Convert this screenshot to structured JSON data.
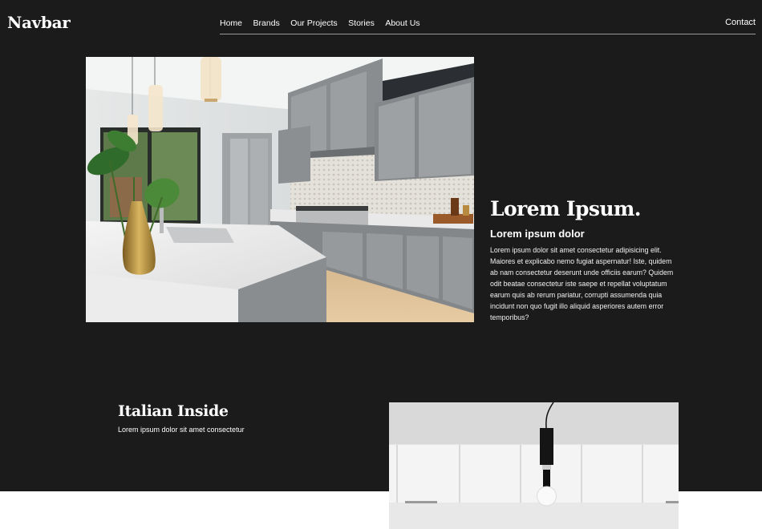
{
  "navbar": {
    "brand": "Navbar",
    "links": [
      "Home",
      "Brands",
      "Our Projects",
      "Stories",
      "About Us"
    ],
    "contact": "Contact"
  },
  "hero": {
    "image_alt": "kitchen-photo",
    "title": "Lorem Ipsum.",
    "subtitle": "Lorem ipsum dolor",
    "body": "Lorem ipsum dolor sit amet consectetur adipisicing elit. Maiores et explicabo nemo fugiat aspernatur! Iste, quidem ab nam consectetur deserunt unde officiis earum? Quidem odit beatae consectetur iste saepe et repellat voluptatum earum quis ab rerum pariatur, corrupti assumenda quia incidunt non quo fugit illo aliquid asperiores autem error temporibus?"
  },
  "italian": {
    "title": "Italian Inside",
    "subtitle": "Lorem ipsum dolor sit amet consectetur"
  },
  "colors": {
    "background_dark": "#1c1b1b",
    "text": "#ffffff",
    "nav_line": "#9a9a9a"
  }
}
